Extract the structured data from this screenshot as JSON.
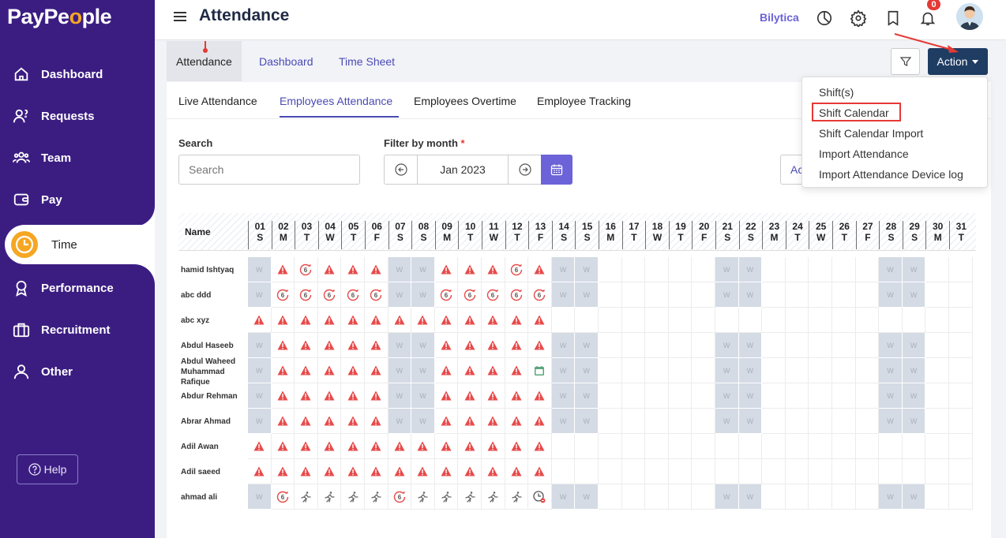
{
  "sidebar": {
    "logo": {
      "part1": "PayPe",
      "part2": "o",
      "part3": "ple"
    },
    "items": [
      {
        "label": "Dashboard",
        "icon": "home-icon"
      },
      {
        "label": "Requests",
        "icon": "requests-icon"
      },
      {
        "label": "Team",
        "icon": "team-icon"
      },
      {
        "label": "Pay",
        "icon": "wallet-icon"
      },
      {
        "label": "Time",
        "icon": "clock-icon",
        "active": true
      },
      {
        "label": "Performance",
        "icon": "award-icon"
      },
      {
        "label": "Recruitment",
        "icon": "briefcase-icon"
      },
      {
        "label": "Other",
        "icon": "user-icon"
      }
    ],
    "help": "Help"
  },
  "header": {
    "title": "Attendance",
    "company": "Bilytica",
    "notifications": "0"
  },
  "subnav": {
    "tabs": [
      "Attendance",
      "Dashboard",
      "Time Sheet"
    ],
    "action_label": "Action"
  },
  "action_menu": {
    "items": [
      "Shift(s)",
      "Shift Calendar",
      "Shift Calendar Import",
      "Import Attendance",
      "Import Attendance Device log"
    ],
    "highlighted": "Shift Calendar"
  },
  "inner_tabs": [
    "Live Attendance",
    "Employees Attendance",
    "Employees Overtime",
    "Employee Tracking"
  ],
  "filters": {
    "search_label": "Search",
    "search_placeholder": "Search",
    "month_label": "Filter by month",
    "required_mark": "*",
    "month_value": "Jan 2023",
    "add_button_partial": "Ac"
  },
  "grid": {
    "name_header": "Name",
    "weekend_mark": "W",
    "days": [
      {
        "d": "01",
        "w": "S"
      },
      {
        "d": "02",
        "w": "M"
      },
      {
        "d": "03",
        "w": "T"
      },
      {
        "d": "04",
        "w": "W"
      },
      {
        "d": "05",
        "w": "T"
      },
      {
        "d": "06",
        "w": "F"
      },
      {
        "d": "07",
        "w": "S"
      },
      {
        "d": "08",
        "w": "S"
      },
      {
        "d": "09",
        "w": "M"
      },
      {
        "d": "10",
        "w": "T"
      },
      {
        "d": "11",
        "w": "W"
      },
      {
        "d": "12",
        "w": "T"
      },
      {
        "d": "13",
        "w": "F"
      },
      {
        "d": "14",
        "w": "S"
      },
      {
        "d": "15",
        "w": "S"
      },
      {
        "d": "16",
        "w": "M"
      },
      {
        "d": "17",
        "w": "T"
      },
      {
        "d": "18",
        "w": "W"
      },
      {
        "d": "19",
        "w": "T"
      },
      {
        "d": "20",
        "w": "F"
      },
      {
        "d": "21",
        "w": "S"
      },
      {
        "d": "22",
        "w": "S"
      },
      {
        "d": "23",
        "w": "M"
      },
      {
        "d": "24",
        "w": "T"
      },
      {
        "d": "25",
        "w": "W"
      },
      {
        "d": "26",
        "w": "T"
      },
      {
        "d": "27",
        "w": "F"
      },
      {
        "d": "28",
        "w": "S"
      },
      {
        "d": "29",
        "w": "S"
      },
      {
        "d": "30",
        "w": "M"
      },
      {
        "d": "31",
        "w": "T"
      }
    ],
    "rows": [
      {
        "name": "hamid Ishtyaq",
        "cells": "WAOAAAWWAAAOAWW"
      },
      {
        "name": "abc ddd",
        "cells": "WOOOOOWWOOOOOWW"
      },
      {
        "name": "abc xyz",
        "cells": "AAAAAAAAAAAAA"
      },
      {
        "name": "Abdul Haseeb",
        "cells": "WAAAAAWWAAAAAWW"
      },
      {
        "name": "Abdul Waheed Muhammad Rafique",
        "cells": "WAAAAAWWAAAACWW"
      },
      {
        "name": "Abdur Rehman",
        "cells": "WAAAAAWWAAAAAWW"
      },
      {
        "name": "Abrar Ahmad",
        "cells": "WAAAAAWWAAAAAWW"
      },
      {
        "name": "Adil Awan",
        "cells": "AAAAAAAAAAAAA"
      },
      {
        "name": "Adil saeed",
        "cells": "AAAAAAAAAAAAA"
      },
      {
        "name": "ahmad ali",
        "cells": "WORRRRORRRRRLWW"
      }
    ],
    "weekend_rows_extra": [
      0,
      1,
      3,
      4,
      5,
      6,
      9
    ]
  },
  "colors": {
    "sidebar": "#3b1d82",
    "accent": "#6c63d8",
    "action": "#1f3d63",
    "alert": "#e53935",
    "weekend": "#d4dbe5"
  }
}
